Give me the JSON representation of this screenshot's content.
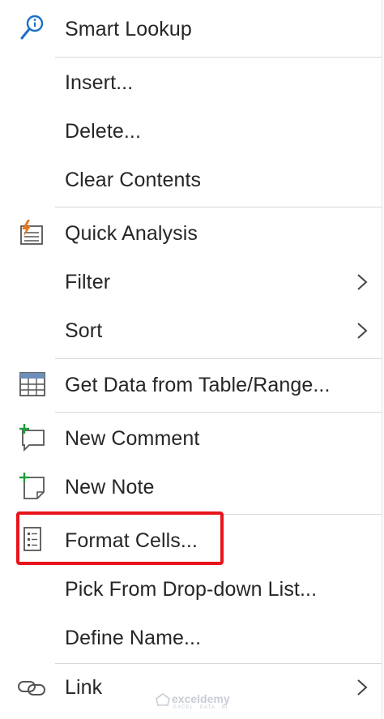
{
  "menu": {
    "items": [
      {
        "label": "Smart Lookup",
        "icon": "smart-lookup-icon"
      },
      {
        "label": "Insert..."
      },
      {
        "label": "Delete..."
      },
      {
        "label": "Clear Contents"
      },
      {
        "label": "Quick Analysis",
        "icon": "quick-analysis-icon"
      },
      {
        "label": "Filter",
        "submenu": true
      },
      {
        "label": "Sort",
        "submenu": true
      },
      {
        "label": "Get Data from Table/Range...",
        "icon": "table-icon"
      },
      {
        "label": "New Comment",
        "icon": "new-comment-icon"
      },
      {
        "label": "New Note",
        "icon": "new-note-icon"
      },
      {
        "label": "Format Cells...",
        "icon": "format-cells-icon",
        "highlighted": true
      },
      {
        "label": "Pick From Drop-down List..."
      },
      {
        "label": "Define Name..."
      },
      {
        "label": "Link",
        "icon": "link-icon",
        "submenu": true
      }
    ]
  },
  "watermark": {
    "text": "exceldemy",
    "subtext": "EXCEL · DATA · BI"
  },
  "colors": {
    "highlight": "#e8141b",
    "accent_blue": "#1e6fc7",
    "accent_green": "#1f9d3a",
    "accent_orange": "#e3781c"
  }
}
